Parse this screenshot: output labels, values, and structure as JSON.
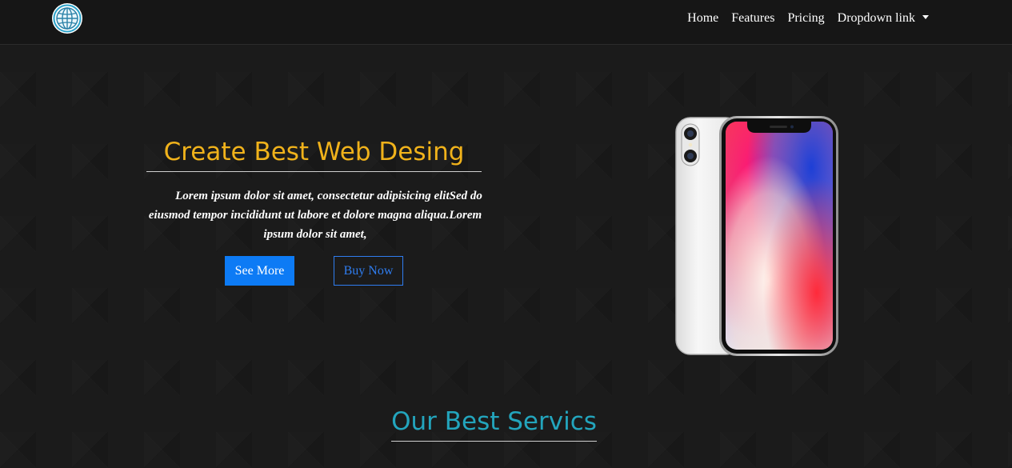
{
  "nav": {
    "logo_icon": "globe-icon",
    "links": [
      {
        "label": "Home"
      },
      {
        "label": "Features"
      },
      {
        "label": "Pricing"
      },
      {
        "label": "Dropdown link"
      }
    ]
  },
  "hero": {
    "title": "Create Best Web Desing",
    "text": "Lorem ipsum dolor sit amet, consectetur adipisicing elitSed do eiusmod tempor incididunt ut labore et dolore magna aliqua.Lorem ipsum dolor sit amet,",
    "primary_button": "See More",
    "secondary_button": "Buy Now",
    "image_icon": "smartphone-image"
  },
  "services": {
    "title": "Our Best Servics"
  },
  "colors": {
    "hero_title": "#f0b21b",
    "section_title": "#23a5bd",
    "primary": "#0d7bf5",
    "background": "#1b1b1b"
  }
}
